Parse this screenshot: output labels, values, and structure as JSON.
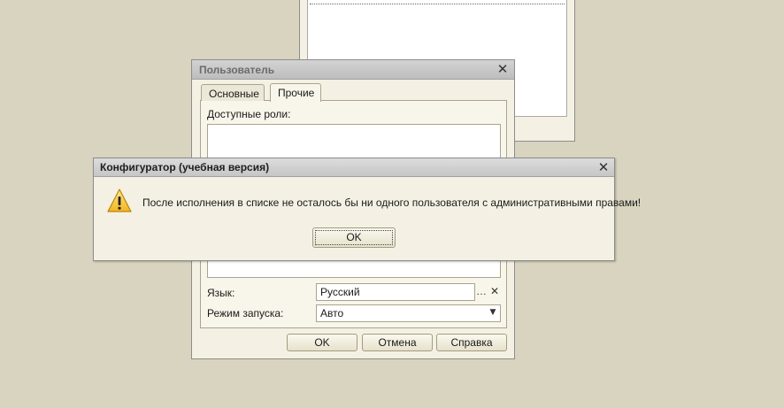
{
  "user_dialog": {
    "title": "Пользователь",
    "tabs": [
      {
        "label": "Основные"
      },
      {
        "label": "Прочие"
      }
    ],
    "roles_label": "Доступные роли:",
    "language_label": "Язык:",
    "language_value": "Русский",
    "launch_mode_label": "Режим запуска:",
    "launch_mode_value": "Авто",
    "buttons": {
      "ok": "OK",
      "cancel": "Отмена",
      "help": "Справка"
    }
  },
  "alert": {
    "title": "Конфигуратор (учебная версия)",
    "message": "После исполнения в списке не осталось бы ни одного пользователя с административными правами!",
    "ok": "OK"
  },
  "icons": {
    "close": "close-icon",
    "warning": "warning-icon",
    "ellipsis": "ellipsis-icon",
    "clear": "clear-icon",
    "dropdown": "chevron-down-icon"
  }
}
